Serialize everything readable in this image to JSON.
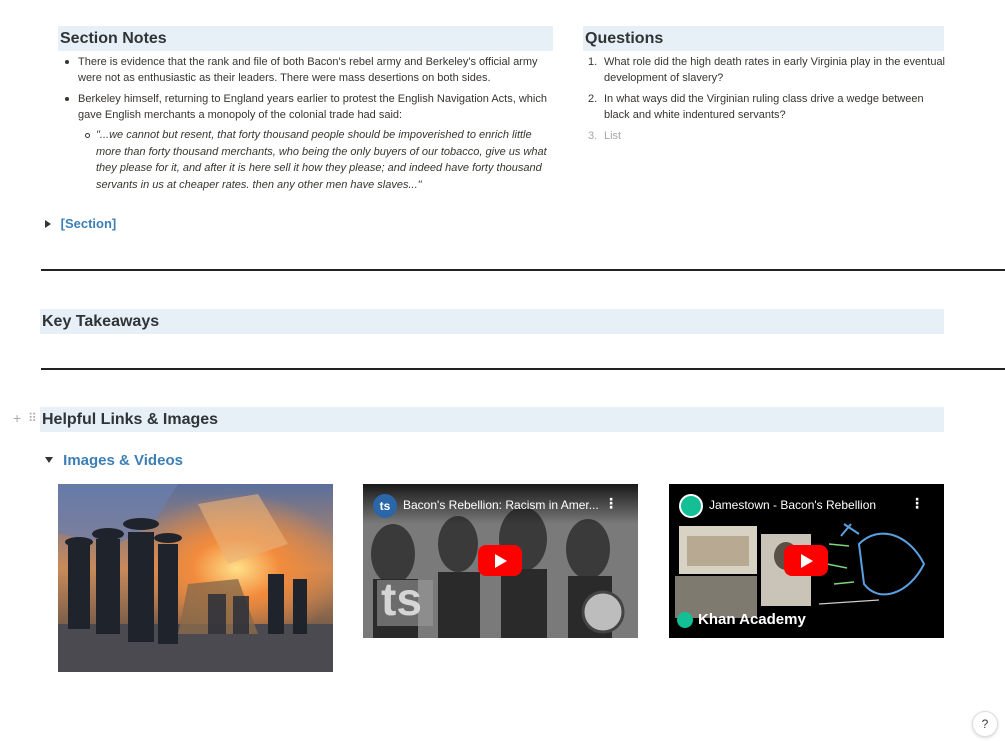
{
  "section_notes": {
    "heading": "Section Notes",
    "bullets": [
      "There is evidence that the rank and file of both Bacon's rebel army and Berkeley's official army were not as enthusiastic as their leaders. There were mass desertions on both sides.",
      "Berkeley himself, returning to England years earlier to protest the English Navigation Acts, which gave English merchants a monopoly of the colonial trade had said:"
    ],
    "quote": "\"...we cannot but resent, that forty thousand people should be impoverished to enrich little more than forty thousand merchants, who being the only buyers of our tobacco, give us what they please for it, and after it is here sell it how they please; and indeed have forty thousand servants in us at cheaper rates. then any other men have slaves...\"",
    "toggle_label": "[Section]"
  },
  "questions": {
    "heading": "Questions",
    "items": [
      {
        "num": "1.",
        "text": "What role did the high death rates in early Virginia play in the eventual development of slavery?"
      },
      {
        "num": "2.",
        "text": "In what ways did the Virginian ruling class drive a wedge between black and white indentured servants?"
      },
      {
        "num": "3.",
        "text": "List"
      }
    ]
  },
  "key_takeaways": {
    "heading": "Key Takeaways"
  },
  "helpful_links": {
    "heading": "Helpful Links & Images",
    "toggle_label": "Images & Videos",
    "videos": [
      {
        "channel_badge": "ts",
        "title": "Bacon's Rebellion: Racism in Amer...",
        "watermark": "ts"
      },
      {
        "title": "Jamestown - Bacon's Rebellion",
        "brand": "Khan Academy"
      }
    ]
  },
  "help_button": "?",
  "block_handle": {
    "add": "+",
    "drag": "⠿"
  },
  "colors": {
    "heading_bg": "#e7f0f7",
    "toggle_blue": "#3d7fb5",
    "youtube_red": "#ff0000",
    "khan_green": "#14bf96"
  }
}
